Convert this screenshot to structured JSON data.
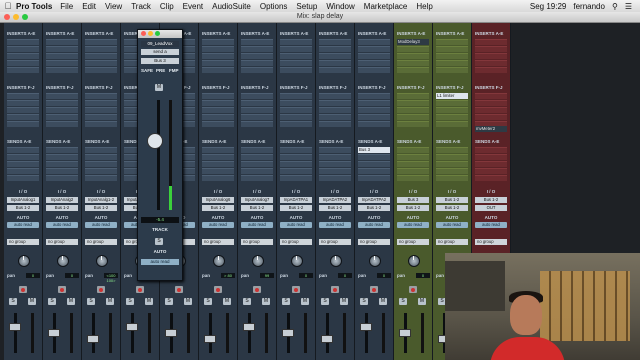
{
  "menubar": {
    "app": "Pro Tools",
    "items": [
      "File",
      "Edit",
      "View",
      "Track",
      "Clip",
      "Event",
      "AudioSuite",
      "Options",
      "Setup",
      "Window",
      "Marketplace",
      "Help"
    ],
    "clock": "Seg 19:29",
    "user": "fernando"
  },
  "window": {
    "title": "Mix: slap delay"
  },
  "strips": [
    {
      "io": "InputAnalog1",
      "out": "Bus 1-2",
      "pan": "0",
      "color": "blue"
    },
    {
      "io": "InputAnalg2",
      "out": "Bus 1-2",
      "pan": "0",
      "color": "blue"
    },
    {
      "io": "InputAnalg1-2",
      "out": "Bus 1-2",
      "pan": "<100 100>",
      "color": "blue"
    },
    {
      "io": "InputAnalg1-2",
      "out": "Bus 1-2",
      "pan": "<100",
      "color": "blue"
    },
    {
      "io": "",
      "out": "",
      "pan": "",
      "color": "blue"
    },
    {
      "io": "InputAnalog6",
      "out": "Bus 1-2",
      "pan": "> 80",
      "color": "blue"
    },
    {
      "io": "InputAnalog7",
      "out": "Bus 1-2",
      "pan": "99",
      "color": "blue"
    },
    {
      "io": "InpADATPA1",
      "out": "Bus 1-2",
      "pan": "0",
      "color": "blue"
    },
    {
      "io": "InpADATPA2",
      "out": "Bus 1-2",
      "pan": "0",
      "color": "blue"
    },
    {
      "io": "InpADATPA2",
      "out": "Bus 1-2",
      "pan": "0",
      "color": "blue"
    },
    {
      "io": "Bus 3",
      "out": "Bus 1-2",
      "pan": "0",
      "color": "green"
    },
    {
      "io": "Bus 1-2",
      "out": "Bus 1-2",
      "pan": "",
      "color": "green"
    },
    {
      "io": "Bus 1-2",
      "out": "OUT",
      "pan": "",
      "color": "red"
    }
  ],
  "labels": {
    "inserts_ae": "INSERTS A-E",
    "inserts_fj": "INSERTS F-J",
    "sends_ae": "SENDS A-E",
    "sends_fj": "SENDS F-J",
    "io": "I / O",
    "auto": "AUTO",
    "auto_read": "auto read",
    "no_group": "no group",
    "pan": "pan",
    "solo": "S",
    "mute": "M"
  },
  "plugins": {
    "moddelay": "ModDelay3",
    "l1_limiter": "L1 limiter",
    "mvmeter": "mvMeter2",
    "bus3_send": "Bus 3"
  },
  "send_window": {
    "track": "09_LeadVox",
    "send": "send a",
    "bus": "Bus 3",
    "safe": "SAFE",
    "pre": "PRE",
    "fmp": "FMP",
    "mute": "M",
    "level": "-5.4",
    "track_label": "TRACK",
    "solo": "S",
    "auto_label": "AUTO",
    "auto_mode": "auto read"
  },
  "colors": {
    "strip_blue": "#2b3745",
    "strip_green": "#4a5a2c",
    "strip_red": "#5a2226",
    "accent_meter": "#3bd13b"
  }
}
